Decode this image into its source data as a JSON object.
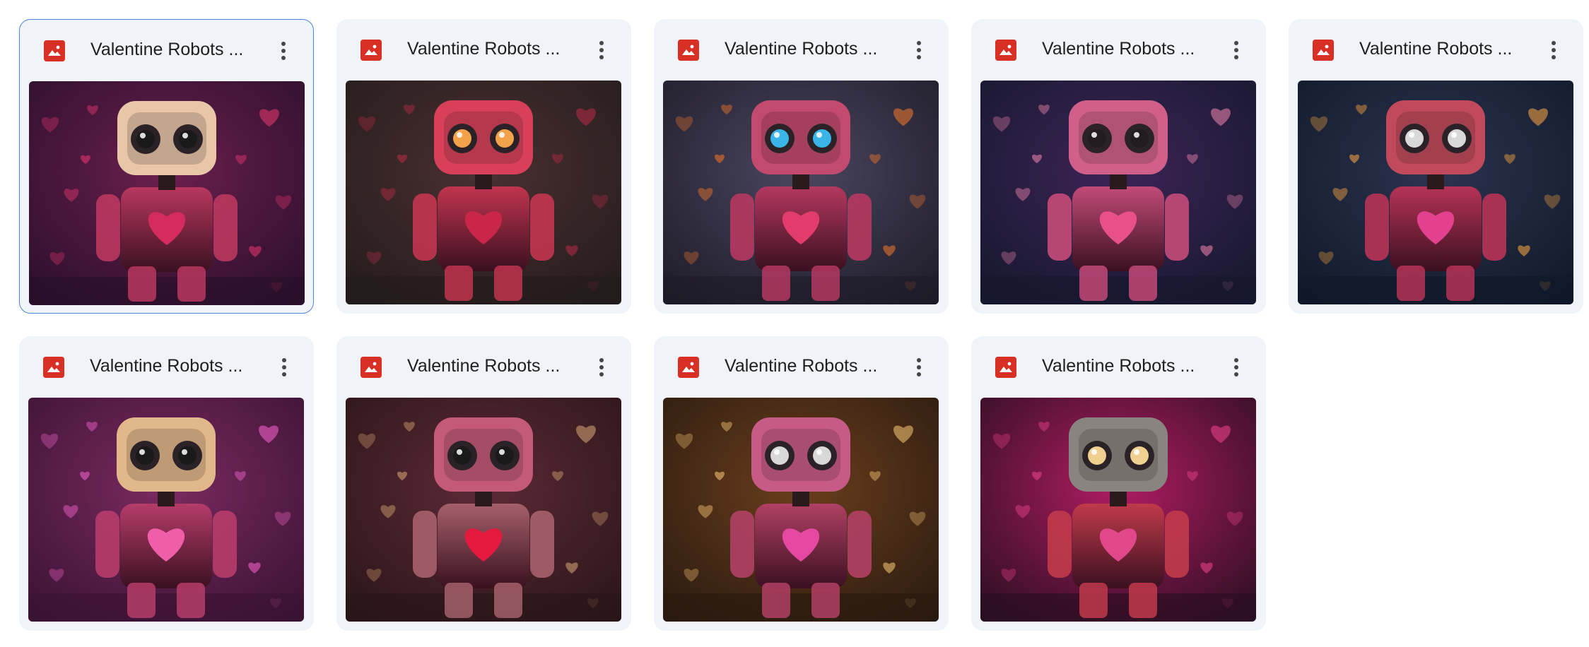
{
  "files": [
    {
      "title": "Valentine Robots ...",
      "type_icon": "image-icon",
      "selected": true,
      "thumb": {
        "bg1": "#2a0f2a",
        "bg2": "#6b1f4e",
        "body": "#b8375f",
        "head": "#e8c6a8",
        "eye": "#1a1a1a",
        "accent": "#e0356d",
        "heart": "#d42a5e"
      }
    },
    {
      "title": "Valentine Robots ...",
      "type_icon": "image-icon",
      "selected": false,
      "thumb": {
        "bg1": "#241b1c",
        "bg2": "#4a3031",
        "body": "#c0344f",
        "head": "#d8405a",
        "eye": "#f2a24a",
        "accent": "#b02a46",
        "heart": "#c92649"
      }
    },
    {
      "title": "Valentine Robots ...",
      "type_icon": "image-icon",
      "selected": false,
      "thumb": {
        "bg1": "#1e1b28",
        "bg2": "#4b4660",
        "body": "#b43860",
        "head": "#c24a6e",
        "eye": "#3bb4e8",
        "accent": "#e7732a",
        "heart": "#e23c6c"
      }
    },
    {
      "title": "Valentine Robots ...",
      "type_icon": "image-icon",
      "selected": false,
      "thumb": {
        "bg1": "#15172e",
        "bg2": "#3d2456",
        "body": "#c24a78",
        "head": "#d0608a",
        "eye": "#231a22",
        "accent": "#e880a8",
        "heart": "#e8508a"
      }
    },
    {
      "title": "Valentine Robots ...",
      "type_icon": "image-icon",
      "selected": false,
      "thumb": {
        "bg1": "#101828",
        "bg2": "#2c3450",
        "body": "#b53356",
        "head": "#c04a5c",
        "eye": "#d9d9d9",
        "accent": "#f0a040",
        "heart": "#e3418f"
      }
    },
    {
      "title": "Valentine Robots ...",
      "type_icon": "image-icon",
      "selected": false,
      "thumb": {
        "bg1": "#3a1233",
        "bg2": "#7a2a60",
        "body": "#b53c6a",
        "head": "#e2b88a",
        "eye": "#1a1a1a",
        "accent": "#f060c8",
        "heart": "#ef5fa9"
      }
    },
    {
      "title": "Valentine Robots ...",
      "type_icon": "image-icon",
      "selected": false,
      "thumb": {
        "bg1": "#2a1518",
        "bg2": "#5c2a36",
        "body": "#a5606a",
        "head": "#c45a78",
        "eye": "#1a1a1a",
        "accent": "#d0a070",
        "heart": "#e5193e"
      }
    },
    {
      "title": "Valentine Robots ...",
      "type_icon": "image-icon",
      "selected": false,
      "thumb": {
        "bg1": "#2a1a10",
        "bg2": "#6a3e1c",
        "body": "#b04064",
        "head": "#c85a88",
        "eye": "#d8d8d8",
        "accent": "#f0c070",
        "heart": "#e448a0"
      }
    },
    {
      "title": "Valentine Robots ...",
      "type_icon": "image-icon",
      "selected": false,
      "thumb": {
        "bg1": "#2a0e20",
        "bg2": "#b01c62",
        "body": "#c03a4a",
        "head": "#8a8480",
        "eye": "#f0d090",
        "accent": "#e8408a",
        "heart": "#e0488a"
      }
    }
  ],
  "more_icon": "more-vertical-icon"
}
